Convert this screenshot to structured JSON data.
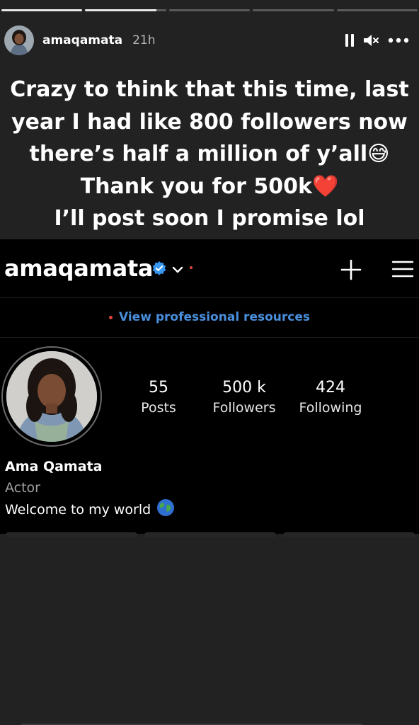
{
  "story": {
    "progress_segments": [
      {
        "state": "done"
      },
      {
        "state": "current",
        "fraction": 0.88
      },
      {
        "state": "pending"
      },
      {
        "state": "pending"
      },
      {
        "state": "pending"
      }
    ],
    "username": "amaqamata",
    "time_ago": "21h",
    "controls": [
      "pause-icon",
      "mute-icon",
      "more-icon"
    ],
    "caption_lines": [
      "Crazy to think that this time, last",
      "year I had like 800 followers now",
      "there’s half a million of y’all😅",
      "Thank you for 500k❤️",
      "I’ll post soon I promise lol"
    ]
  },
  "profile": {
    "handle": "amaqamata",
    "verified": true,
    "pro_link": "View professional resources",
    "stats": [
      {
        "value": "55",
        "label": "Posts"
      },
      {
        "value": "500 k",
        "label": "Followers"
      },
      {
        "value": "424",
        "label": "Following"
      }
    ],
    "name": "Ama Qamata",
    "category": "Actor",
    "bio": "Welcome to my world",
    "bio_emoji": "globe-icon"
  },
  "colors": {
    "story_bg": "#222222",
    "screenshot_bg": "#000000",
    "link_blue": "#4a8fdd",
    "notification_red": "#e0443e",
    "verified_blue": "#3897f0"
  }
}
